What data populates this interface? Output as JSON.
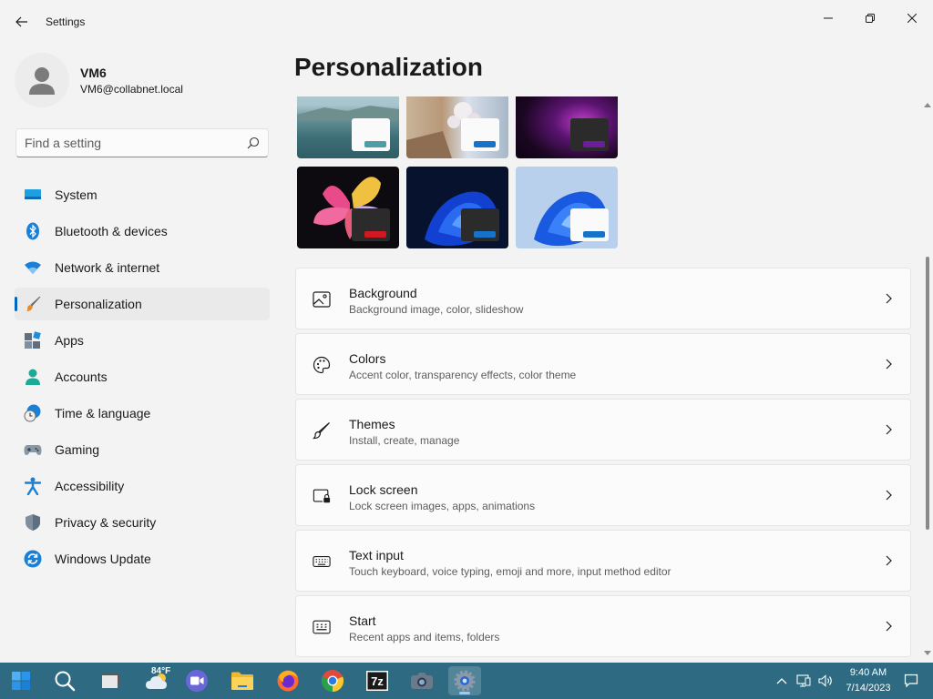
{
  "window": {
    "title": "Settings",
    "icons": {
      "back": "back-arrow-icon",
      "minimize": "minimize-icon",
      "maximize": "maximize-icon",
      "close": "close-icon"
    }
  },
  "profile": {
    "name": "VM6",
    "email": "VM6@collabnet.local"
  },
  "search": {
    "placeholder": "Find a setting",
    "value": ""
  },
  "nav": {
    "items": [
      {
        "label": "System",
        "icon": "system-icon",
        "active": false
      },
      {
        "label": "Bluetooth & devices",
        "icon": "bluetooth-icon",
        "active": false
      },
      {
        "label": "Network & internet",
        "icon": "network-icon",
        "active": false
      },
      {
        "label": "Personalization",
        "icon": "brush-icon",
        "active": true
      },
      {
        "label": "Apps",
        "icon": "apps-icon",
        "active": false
      },
      {
        "label": "Accounts",
        "icon": "accounts-icon",
        "active": false
      },
      {
        "label": "Time & language",
        "icon": "time-language-icon",
        "active": false
      },
      {
        "label": "Gaming",
        "icon": "gaming-icon",
        "active": false
      },
      {
        "label": "Accessibility",
        "icon": "accessibility-icon",
        "active": false
      },
      {
        "label": "Privacy & security",
        "icon": "shield-icon",
        "active": false
      },
      {
        "label": "Windows Update",
        "icon": "windows-update-icon",
        "active": false
      }
    ]
  },
  "main": {
    "title": "Personalization",
    "themes": [
      {
        "name": "lake-theme",
        "accent": "#4f9da6",
        "mode": "light"
      },
      {
        "name": "blossom-theme",
        "accent": "#1673c7",
        "mode": "light"
      },
      {
        "name": "glow-theme",
        "accent": "#6b1d9c",
        "mode": "dark"
      },
      {
        "name": "flower-theme",
        "accent": "#d01a20",
        "mode": "dark"
      },
      {
        "name": "bloom-dark-theme",
        "accent": "#1673c7",
        "mode": "dark"
      },
      {
        "name": "bloom-light-theme",
        "accent": "#1673c7",
        "mode": "light"
      }
    ],
    "settings": [
      {
        "title": "Background",
        "subtitle": "Background image, color, slideshow",
        "icon": "image-icon"
      },
      {
        "title": "Colors",
        "subtitle": "Accent color, transparency effects, color theme",
        "icon": "palette-icon"
      },
      {
        "title": "Themes",
        "subtitle": "Install, create, manage",
        "icon": "brush-icon"
      },
      {
        "title": "Lock screen",
        "subtitle": "Lock screen images, apps, animations",
        "icon": "lock-screen-icon"
      },
      {
        "title": "Text input",
        "subtitle": "Touch keyboard, voice typing, emoji and more, input method editor",
        "icon": "keyboard-icon"
      },
      {
        "title": "Start",
        "subtitle": "Recent apps and items, folders",
        "icon": "start-icon"
      }
    ]
  },
  "taskbar": {
    "apps": [
      {
        "name": "start-button",
        "icon": "windows-logo-icon",
        "active": false
      },
      {
        "name": "search-button",
        "icon": "search-icon",
        "active": false
      },
      {
        "name": "task-view-button",
        "icon": "task-view-icon",
        "active": false
      },
      {
        "name": "weather-widget",
        "icon": "weather-cloud-icon",
        "active": false
      },
      {
        "name": "teams-chat-button",
        "icon": "teams-icon",
        "active": false
      },
      {
        "name": "file-explorer-button",
        "icon": "folder-icon",
        "active": false
      },
      {
        "name": "firefox-button",
        "icon": "firefox-icon",
        "active": false
      },
      {
        "name": "chrome-button",
        "icon": "chrome-icon",
        "active": false
      },
      {
        "name": "7zip-button",
        "icon": "7zip-icon",
        "active": false
      },
      {
        "name": "camera-button",
        "icon": "camera-icon",
        "active": false
      },
      {
        "name": "settings-button",
        "icon": "settings-gear-icon",
        "active": true
      }
    ],
    "weather_temp": "84°F",
    "time": "9:40 AM",
    "date": "7/14/2023",
    "tray_icons": [
      "chevron-up-icon",
      "network-tray-icon",
      "volume-icon",
      "notification-icon"
    ]
  },
  "colors": {
    "accent": "#0067c0",
    "taskbar": "#2e6b83",
    "window_bg": "#f3f3f3",
    "card_bg": "#fbfbfb"
  }
}
